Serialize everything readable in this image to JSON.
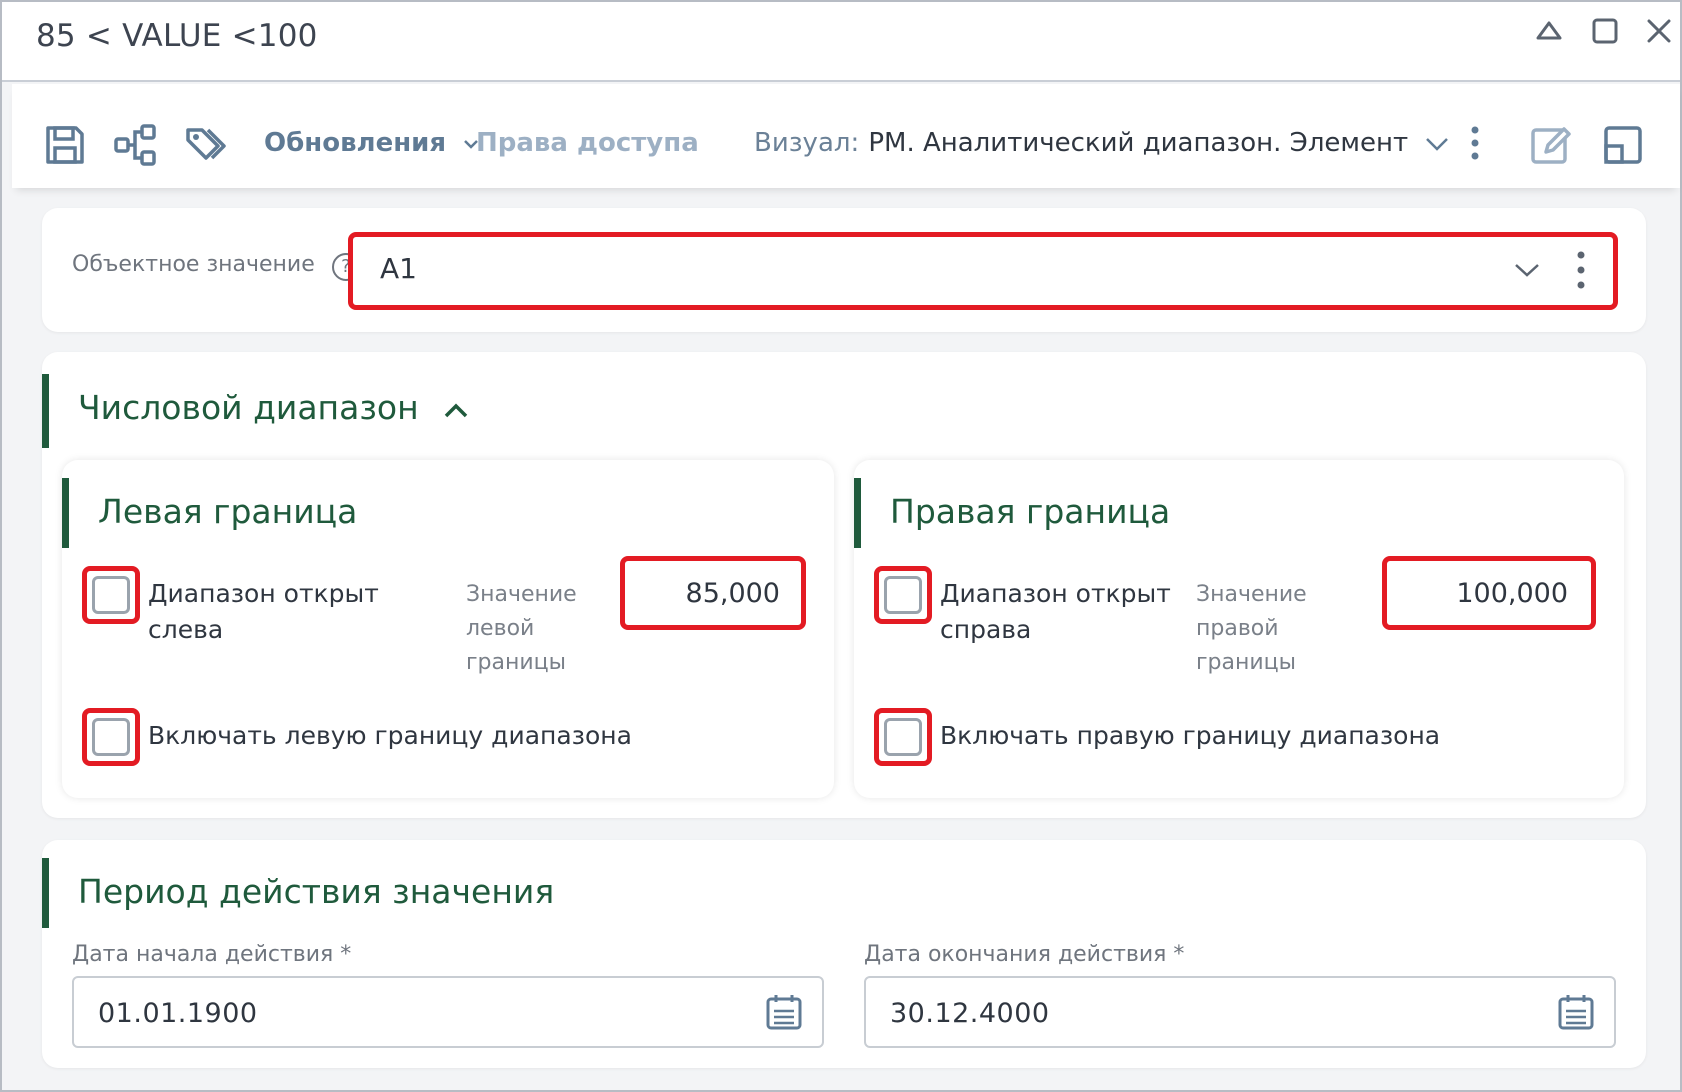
{
  "window": {
    "title": "85 < VALUE <100"
  },
  "toolbar": {
    "updates_label": "Обновления",
    "access_label": "Права доступа",
    "visual_label": "Визуал:",
    "visual_value": "РМ. Аналитический диапазон. Элемент"
  },
  "object_value": {
    "label": "Объектное значение",
    "help": "?",
    "value": "A1"
  },
  "range": {
    "title": "Числовой диапазон",
    "left": {
      "title": "Левая граница",
      "open_label": "Диапазон открыт слева",
      "value_label": "Значение левой границы",
      "value": "85,000",
      "include_label": "Включать левую границу диапазона",
      "open_checked": false,
      "include_checked": false
    },
    "right": {
      "title": "Правая граница",
      "open_label": "Диапазон открыт справа",
      "value_label": "Значение правой границы",
      "value": "100,000",
      "include_label": "Включать правую границу диапазона",
      "open_checked": false,
      "include_checked": false
    }
  },
  "period": {
    "title": "Период действия значения",
    "start_label": "Дата начала действия *",
    "start_value": "01.01.1900",
    "end_label": "Дата окончания действия *",
    "end_value": "30.12.4000"
  },
  "colors": {
    "accent_green": "#1f5a3c",
    "highlight_red": "#e31b23",
    "toolbar_blue": "#5f7a94"
  }
}
